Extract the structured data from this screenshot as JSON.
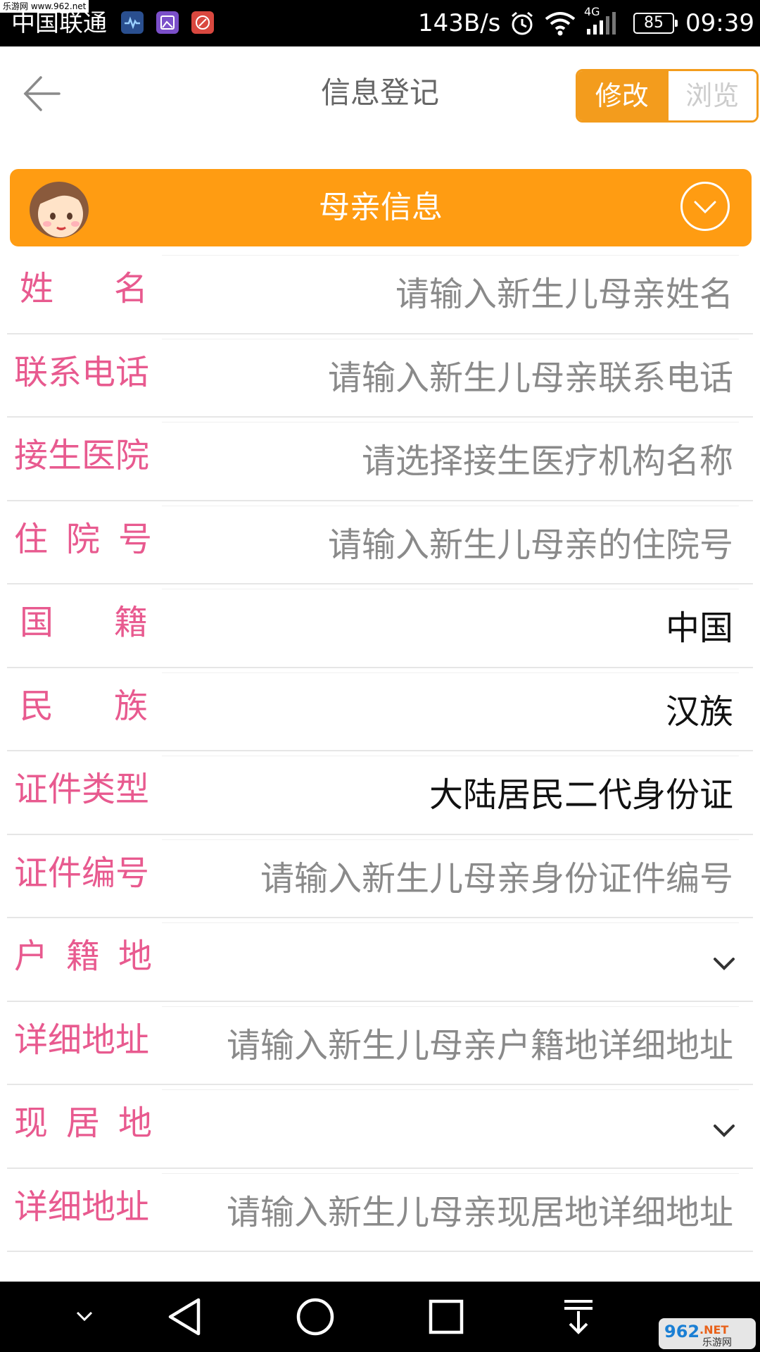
{
  "status_bar": {
    "watermark": "乐游网 www.962.net",
    "carrier": "中国联通",
    "app_icons": [
      "health-app-icon",
      "gallery-app-icon",
      "tool-app-icon"
    ],
    "net_speed": "143B/s",
    "network_type": "4G",
    "battery": "85",
    "time": "09:39"
  },
  "header": {
    "title": "信息登记",
    "segment": {
      "edit_label": "修改",
      "browse_label": "浏览",
      "active": "修改"
    }
  },
  "section": {
    "title": "母亲信息"
  },
  "form": {
    "rows": [
      {
        "label": [
          "姓",
          "名"
        ],
        "text": "请输入新生儿母亲姓名",
        "kind": "placeholder"
      },
      {
        "label": [
          "联系电话"
        ],
        "text": "请输入新生儿母亲联系电话",
        "kind": "placeholder"
      },
      {
        "label": [
          "接生医院"
        ],
        "text": "请选择接生医疗机构名称",
        "kind": "placeholder"
      },
      {
        "label": [
          "住",
          "院",
          "号"
        ],
        "text": "请输入新生儿母亲的住院号",
        "kind": "placeholder"
      },
      {
        "label": [
          "国",
          "籍"
        ],
        "text": "中国",
        "kind": "value"
      },
      {
        "label": [
          "民",
          "族"
        ],
        "text": "汉族",
        "kind": "value"
      },
      {
        "label": [
          "证件类型"
        ],
        "text": "大陆居民二代身份证",
        "kind": "value"
      },
      {
        "label": [
          "证件编号"
        ],
        "text": "请输入新生儿母亲身份证件编号",
        "kind": "placeholder"
      },
      {
        "label": [
          "户",
          "籍",
          "地"
        ],
        "text": "",
        "kind": "dropdown"
      },
      {
        "label": [
          "详细地址"
        ],
        "text": "请输入新生儿母亲户籍地详细地址",
        "kind": "placeholder"
      },
      {
        "label": [
          "现",
          "居",
          "地"
        ],
        "text": "",
        "kind": "dropdown"
      },
      {
        "label": [
          "详细地址"
        ],
        "text": "请输入新生儿母亲现居地详细地址",
        "kind": "placeholder"
      }
    ]
  },
  "nav_bar": {
    "buttons": [
      "hide-nav-icon",
      "back-triangle-icon",
      "home-circle-icon",
      "recents-square-icon",
      "notification-pull-icon"
    ],
    "watermark": "962.NET 乐游网"
  },
  "colors": {
    "accent_orange": "#f39c1d",
    "banner_orange": "#ff9c12",
    "label_pink": "#e85a8f",
    "placeholder_gray": "#8a8a8a"
  }
}
